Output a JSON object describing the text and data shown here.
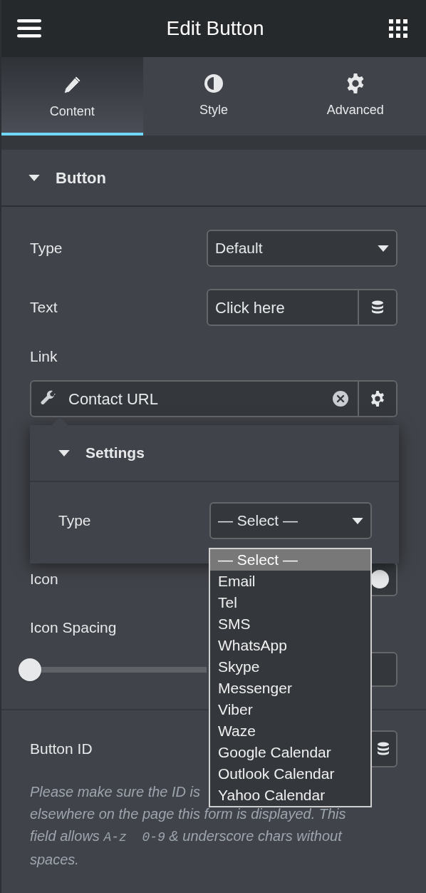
{
  "header": {
    "title": "Edit Button"
  },
  "tabs": [
    {
      "label": "Content",
      "kind": "pencil",
      "selected": true
    },
    {
      "label": "Style",
      "kind": "contrast",
      "selected": false
    },
    {
      "label": "Advanced",
      "kind": "gear",
      "selected": false
    }
  ],
  "section": {
    "title": "Button",
    "expanded": true
  },
  "fields": {
    "type": {
      "label": "Type",
      "value": "Default"
    },
    "text": {
      "label": "Text",
      "value": "Click here"
    },
    "link_label": "Link",
    "link": {
      "value": "Contact URL"
    },
    "icon": {
      "label": "Icon"
    },
    "icon_spacing": {
      "label": "Icon Spacing",
      "level": 0
    },
    "button_id": {
      "label": "Button ID"
    }
  },
  "help_lines": [
    [
      {
        "text": "Please make sure the ID is"
      }
    ],
    [
      {
        "text": "elsewhere on the page this form is displayed. This"
      }
    ],
    [
      {
        "text": "field allows "
      },
      {
        "text": "A-z  0-9",
        "kind": "code"
      },
      {
        "text": " & underscore chars without"
      }
    ],
    [
      {
        "text": "spaces."
      }
    ]
  ],
  "link_settings": {
    "title": "Settings",
    "expanded": true,
    "type_label": "Type",
    "type_value": "— Select —"
  },
  "dropdown": {
    "options": [
      {
        "label": "— Select —",
        "selected": true
      },
      {
        "label": "Email",
        "selected": false
      },
      {
        "label": "Tel",
        "selected": false
      },
      {
        "label": "SMS",
        "selected": false
      },
      {
        "label": "WhatsApp",
        "selected": false
      },
      {
        "label": "Skype",
        "selected": false
      },
      {
        "label": "Messenger",
        "selected": false
      },
      {
        "label": "Viber",
        "selected": false
      },
      {
        "label": "Waze",
        "selected": false
      },
      {
        "label": "Google Calendar",
        "selected": false
      },
      {
        "label": "Outlook Calendar",
        "selected": false
      },
      {
        "label": "Yahoo Calendar",
        "selected": false
      }
    ]
  }
}
